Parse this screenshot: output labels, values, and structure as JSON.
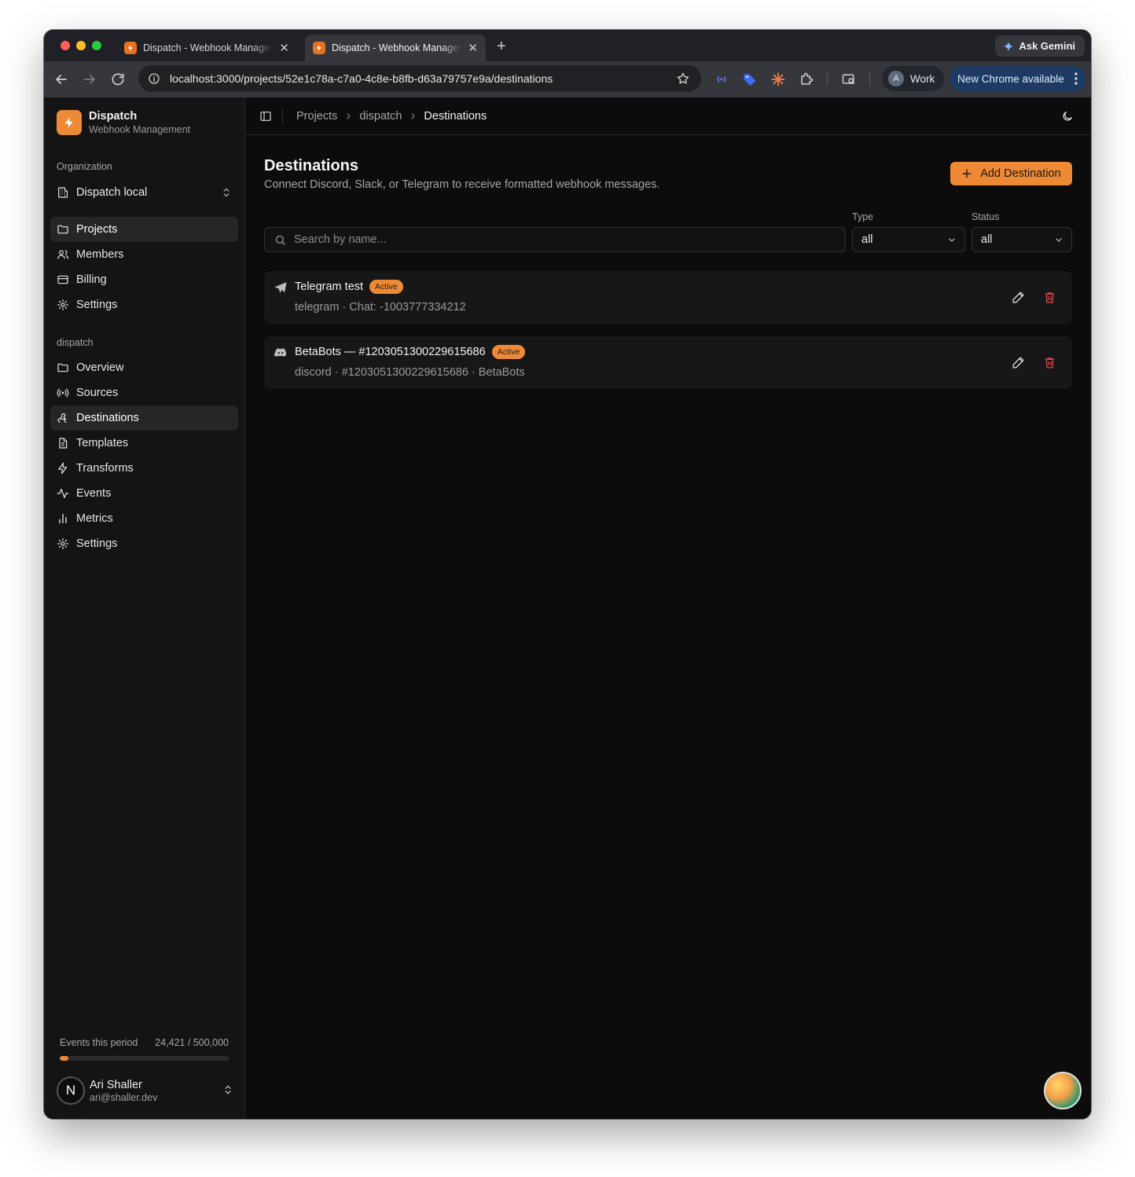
{
  "browser": {
    "tabs": [
      {
        "title": "Dispatch - Webhook Management",
        "active": false
      },
      {
        "title": "Dispatch - Webhook Management",
        "active": true
      }
    ],
    "ask_gemini": "Ask Gemini",
    "url": "localhost:3000/projects/52e1c78a-c7a0-4c8e-b8fb-d63a79757e9a/destinations",
    "profile_initial": "A",
    "profile_label": "Work",
    "update_label": "New Chrome available"
  },
  "sidebar": {
    "brand_name": "Dispatch",
    "brand_sub": "Webhook Management",
    "org_label": "Organization",
    "org_name": "Dispatch local",
    "org_items": [
      {
        "label": "Projects",
        "icon": "folder-icon",
        "active": true
      },
      {
        "label": "Members",
        "icon": "users-icon",
        "active": false
      },
      {
        "label": "Billing",
        "icon": "credit-card-icon",
        "active": false
      },
      {
        "label": "Settings",
        "icon": "gear-icon",
        "active": false
      }
    ],
    "project_label": "dispatch",
    "project_items": [
      {
        "label": "Overview",
        "icon": "folder-icon",
        "active": false
      },
      {
        "label": "Sources",
        "icon": "radio-icon",
        "active": false
      },
      {
        "label": "Destinations",
        "icon": "webhook-icon",
        "active": true
      },
      {
        "label": "Templates",
        "icon": "file-text-icon",
        "active": false
      },
      {
        "label": "Transforms",
        "icon": "zap-icon",
        "active": false
      },
      {
        "label": "Events",
        "icon": "activity-icon",
        "active": false
      },
      {
        "label": "Metrics",
        "icon": "bar-chart-icon",
        "active": false
      },
      {
        "label": "Settings",
        "icon": "gear-icon",
        "active": false
      }
    ],
    "usage_label": "Events this period",
    "usage_value": "24,421 / 500,000",
    "usage_fraction": 0.049,
    "user_initial": "N",
    "user_name": "Ari Shaller",
    "user_email": "ari@shaller.dev"
  },
  "breadcrumb": [
    "Projects",
    "dispatch",
    "Destinations"
  ],
  "page": {
    "title": "Destinations",
    "subtitle": "Connect Discord, Slack, or Telegram to receive formatted webhook messages.",
    "add_button": "Add Destination",
    "search_placeholder": "Search by name...",
    "type_label": "Type",
    "type_value": "all",
    "status_label": "Status",
    "status_value": "all"
  },
  "destinations": [
    {
      "name": "Telegram test",
      "status": "Active",
      "meta": "telegram · Chat: -1003777334212",
      "icon": "send-icon"
    },
    {
      "name": "BetaBots — #1203051300229615686",
      "status": "Active",
      "meta": "discord · #1203051300229615686 · BetaBots",
      "icon": "discord-icon"
    }
  ],
  "colors": {
    "accent": "#ee8a36",
    "background": "#0c0c0c",
    "sidebar": "#141414",
    "card": "#171717",
    "danger": "#e5484d"
  }
}
